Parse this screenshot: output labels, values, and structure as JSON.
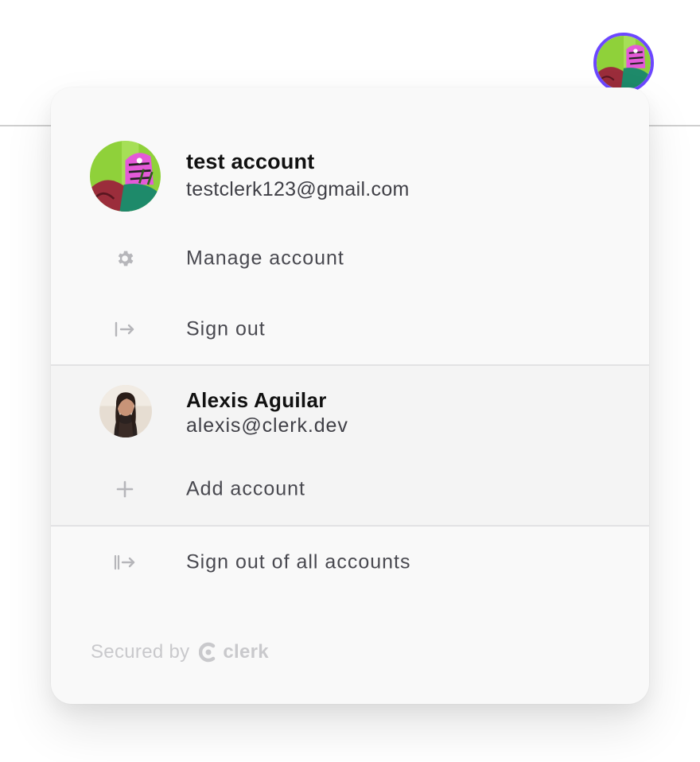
{
  "header": {
    "avatar_alt": "test account",
    "accent_color": "#6c47ff"
  },
  "active_account": {
    "name": "test account",
    "email": "testclerk123@gmail.com",
    "avatar_icon": "tiger-avatar"
  },
  "menu": {
    "manage_account": {
      "label": "Manage account",
      "icon": "gear-icon"
    },
    "sign_out": {
      "label": "Sign out",
      "icon": "sign-out-icon"
    }
  },
  "other_account": {
    "name": "Alexis Aguilar",
    "email": "alexis@clerk.dev",
    "avatar_icon": "person-photo-avatar"
  },
  "add_account": {
    "label": "Add account",
    "icon": "plus-icon"
  },
  "sign_out_all": {
    "label": "Sign out of all accounts",
    "icon": "sign-out-all-icon"
  },
  "footer": {
    "secured_by": "Secured by",
    "brand": "clerk"
  }
}
